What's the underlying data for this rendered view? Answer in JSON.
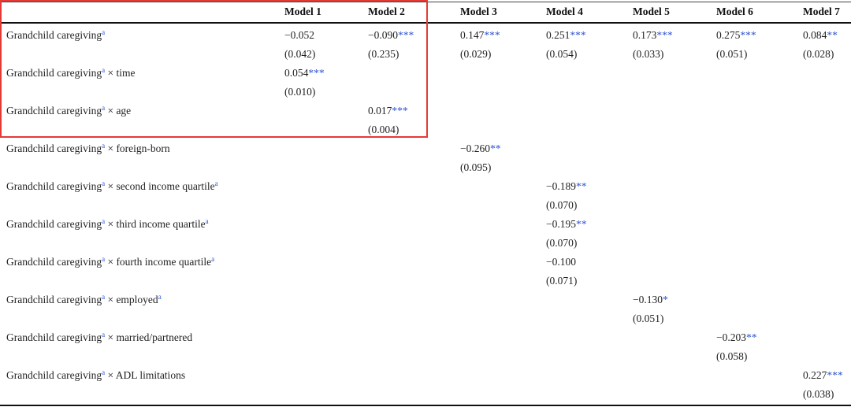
{
  "table": {
    "headers": [
      "Model 1",
      "Model 2",
      "Model 3",
      "Model 4",
      "Model 5",
      "Model 6",
      "Model 7"
    ],
    "rows": [
      {
        "label_main": "Grandchild caregiving",
        "label_sup": "a",
        "label_rest": "",
        "label_rest_sup": "",
        "cells": [
          {
            "coef": "−0.052",
            "stars": "",
            "se": "(0.042)"
          },
          {
            "coef": "−0.090",
            "stars": "***",
            "se": "(0.235)"
          },
          {
            "coef": "0.147",
            "stars": "***",
            "se": "(0.029)"
          },
          {
            "coef": "0.251",
            "stars": "***",
            "se": "(0.054)"
          },
          {
            "coef": "0.173",
            "stars": "***",
            "se": "(0.033)"
          },
          {
            "coef": "0.275",
            "stars": "***",
            "se": "(0.051)"
          },
          {
            "coef": "0.084",
            "stars": "**",
            "se": "(0.028)"
          }
        ]
      },
      {
        "label_main": "Grandchild caregiving",
        "label_sup": "a",
        "label_rest": " × time",
        "label_rest_sup": "",
        "cells": [
          {
            "coef": "0.054",
            "stars": "***",
            "se": "(0.010)"
          },
          null,
          null,
          null,
          null,
          null,
          null
        ]
      },
      {
        "label_main": "Grandchild caregiving",
        "label_sup": "a",
        "label_rest": " × age",
        "label_rest_sup": "",
        "cells": [
          null,
          {
            "coef": "0.017",
            "stars": "***",
            "se": "(0.004)"
          },
          null,
          null,
          null,
          null,
          null
        ]
      },
      {
        "label_main": "Grandchild caregiving",
        "label_sup": "a",
        "label_rest": " × foreign-born",
        "label_rest_sup": "",
        "cells": [
          null,
          null,
          {
            "coef": "−0.260",
            "stars": "**",
            "se": "(0.095)"
          },
          null,
          null,
          null,
          null
        ]
      },
      {
        "label_main": "Grandchild caregiving",
        "label_sup": "a",
        "label_rest": " × second income quartile",
        "label_rest_sup": "a",
        "cells": [
          null,
          null,
          null,
          {
            "coef": "−0.189",
            "stars": "**",
            "se": "(0.070)"
          },
          null,
          null,
          null
        ]
      },
      {
        "label_main": "Grandchild caregiving",
        "label_sup": "a",
        "label_rest": " × third income quartile",
        "label_rest_sup": "a",
        "cells": [
          null,
          null,
          null,
          {
            "coef": "−0.195",
            "stars": "**",
            "se": "(0.070)"
          },
          null,
          null,
          null
        ]
      },
      {
        "label_main": "Grandchild caregiving",
        "label_sup": "a",
        "label_rest": " × fourth income quartile",
        "label_rest_sup": "a",
        "cells": [
          null,
          null,
          null,
          {
            "coef": "−0.100",
            "stars": "",
            "se": "(0.071)"
          },
          null,
          null,
          null
        ]
      },
      {
        "label_main": "Grandchild caregiving",
        "label_sup": "a",
        "label_rest": " × employed",
        "label_rest_sup": "a",
        "cells": [
          null,
          null,
          null,
          null,
          {
            "coef": "−0.130",
            "stars": "*",
            "se": "(0.051)"
          },
          null,
          null
        ]
      },
      {
        "label_main": "Grandchild caregiving",
        "label_sup": "a",
        "label_rest": " × married/partnered",
        "label_rest_sup": "",
        "cells": [
          null,
          null,
          null,
          null,
          null,
          {
            "coef": "−0.203",
            "stars": "**",
            "se": "(0.058)"
          },
          null
        ]
      },
      {
        "label_main": "Grandchild caregiving",
        "label_sup": "a",
        "label_rest": " × ADL limitations",
        "label_rest_sup": "",
        "cells": [
          null,
          null,
          null,
          null,
          null,
          null,
          {
            "coef": "0.227",
            "stars": "***",
            "se": "(0.038)"
          }
        ]
      }
    ]
  },
  "colors": {
    "stars": "#2f55d4",
    "superscript": "#2f55d4",
    "highlight_border": "#e53935",
    "text": "#222222",
    "rules": "#111111"
  }
}
